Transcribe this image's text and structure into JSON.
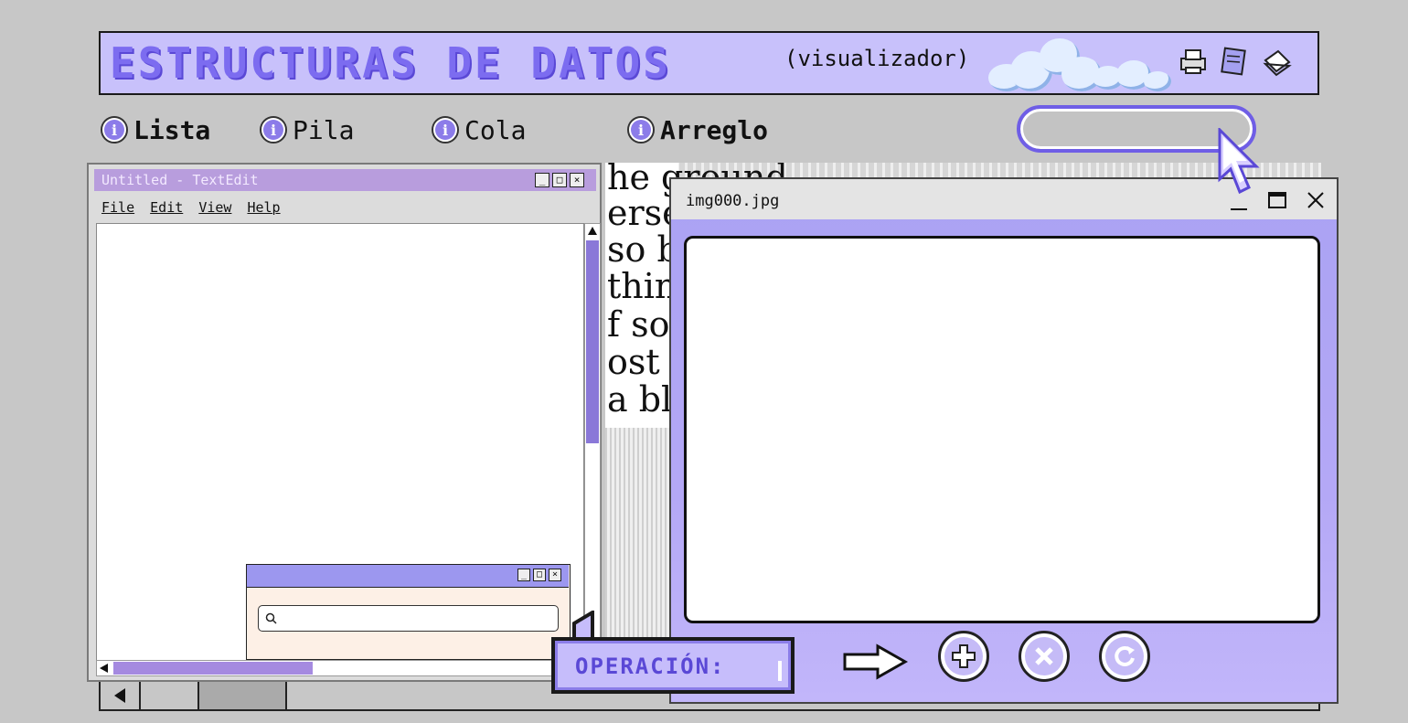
{
  "header": {
    "title": "ESTRUCTURAS DE DATOS",
    "subtitle": "(visualizador)",
    "icons": [
      "printer-icon",
      "notepad-icon",
      "document-stack-icon"
    ]
  },
  "nav": {
    "items": [
      {
        "label": "Lista",
        "icon": "info-icon",
        "bold": true
      },
      {
        "label": "Pila",
        "icon": "info-icon",
        "bold": false
      },
      {
        "label": "Cola",
        "icon": "info-icon",
        "bold": false
      },
      {
        "label": "Arreglo",
        "icon": "info-icon",
        "bold": true
      }
    ],
    "search_value": ""
  },
  "newspaper": {
    "lines": [
      "he ground",
      "erse",
      "so b",
      "thing",
      "f som",
      "ost c",
      "a blo"
    ]
  },
  "textedit": {
    "title": "Untitled - TextEdit",
    "menu": [
      "File",
      "Edit",
      "View",
      "Help"
    ],
    "content": ""
  },
  "mini_search": {
    "value": ""
  },
  "image_window": {
    "title": "img000.jpg"
  },
  "operation": {
    "label": "OPERACIÓN:",
    "buttons": [
      "next-arrow-icon",
      "add-icon",
      "delete-icon",
      "reset-icon"
    ]
  },
  "colors": {
    "accent": "#7c6cf0",
    "header_bg": "#c8c1fb",
    "window_bg": "#b4a8f6",
    "textedit_title": "#b89ddd"
  }
}
